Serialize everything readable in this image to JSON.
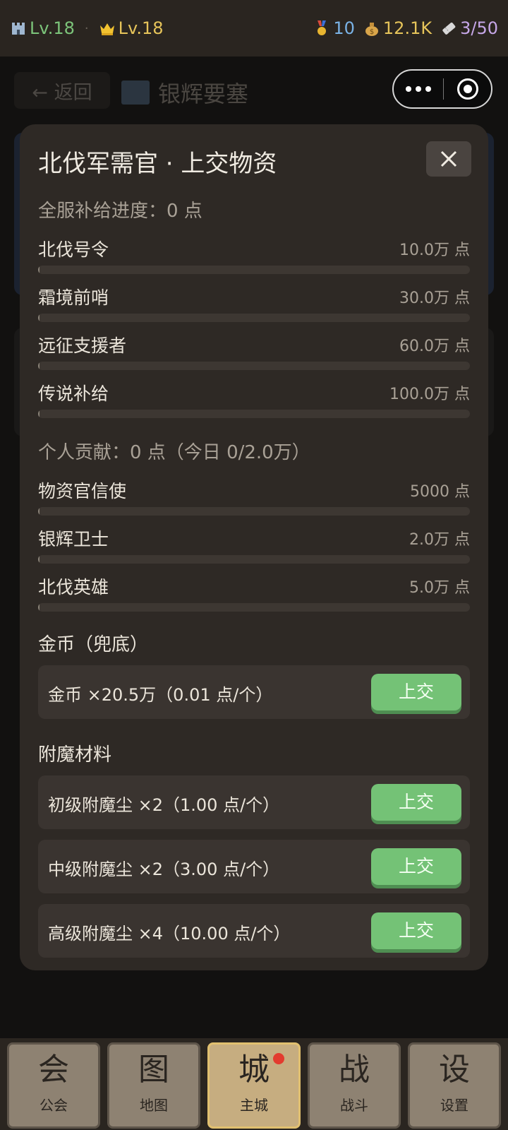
{
  "topbar": {
    "castle_level": "Lv.18",
    "crown_level": "Lv.18",
    "separator": "·",
    "medals": "10",
    "money": "12.1K",
    "tickets": "3/50"
  },
  "background_page": {
    "back_label": "← 返回",
    "title": "银辉要塞"
  },
  "modal": {
    "title": "北伐军需官 · 上交物资",
    "server_progress_header": "全服补给进度：0 点",
    "server_milestones": [
      {
        "name": "北伐号令",
        "value": "10.0万 点",
        "progress": 0
      },
      {
        "name": "霜境前哨",
        "value": "30.0万 点",
        "progress": 0
      },
      {
        "name": "远征支援者",
        "value": "60.0万 点",
        "progress": 0
      },
      {
        "name": "传说补给",
        "value": "100.0万 点",
        "progress": 0
      }
    ],
    "personal_header": "个人贡献：0 点（今日 0/2.0万）",
    "personal_milestones": [
      {
        "name": "物资官信使",
        "value": "5000 点",
        "progress": 0
      },
      {
        "name": "银辉卫士",
        "value": "2.0万 点",
        "progress": 0
      },
      {
        "name": "北伐英雄",
        "value": "5.0万 点",
        "progress": 0
      }
    ],
    "gold_header": "金币（兜底）",
    "gold_row": {
      "label": "金币 ×20.5万（0.01 点/个）",
      "button": "上交"
    },
    "enchant_header": "附魔材料",
    "enchant_rows": [
      {
        "label": "初级附魔尘 ×2（1.00 点/个）",
        "button": "上交"
      },
      {
        "label": "中级附魔尘 ×2（3.00 点/个）",
        "button": "上交"
      },
      {
        "label": "高级附魔尘 ×4（10.00 点/个）",
        "button": "上交"
      }
    ]
  },
  "bottom_nav": [
    {
      "glyph": "会",
      "label": "公会"
    },
    {
      "glyph": "图",
      "label": "地图"
    },
    {
      "glyph": "城",
      "label": "主城"
    },
    {
      "glyph": "战",
      "label": "战斗"
    },
    {
      "glyph": "设",
      "label": "设置"
    }
  ]
}
